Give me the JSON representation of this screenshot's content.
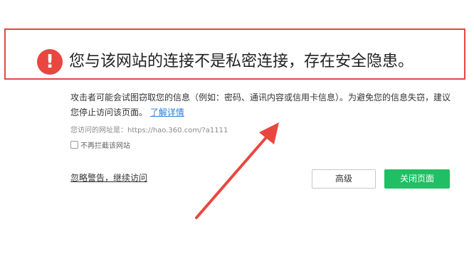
{
  "warning": {
    "icon": "exclamation-icon",
    "headline": "您与该网站的连接不是私密连接，存在安全隐患。",
    "description": "攻击者可能会试图窃取您的信息（例如：密码、通讯内容或信用卡信息）。为避免您的信息失窃，建议您停止访问该页面。",
    "learn_more_label": "了解详情"
  },
  "url_line": "您访问的网址是：https://hao.360.com/?a1111",
  "checkbox": {
    "label": "不再拦截该网站",
    "checked": false
  },
  "ignore_link_label": "忽略警告，继续访问",
  "buttons": {
    "advanced_label": "高级",
    "close_label": "关闭页面"
  },
  "colors": {
    "warning_red": "#e8473f",
    "highlight_red": "#e64545",
    "link_blue": "#2f7cd6",
    "primary_green": "#1fbf63"
  }
}
